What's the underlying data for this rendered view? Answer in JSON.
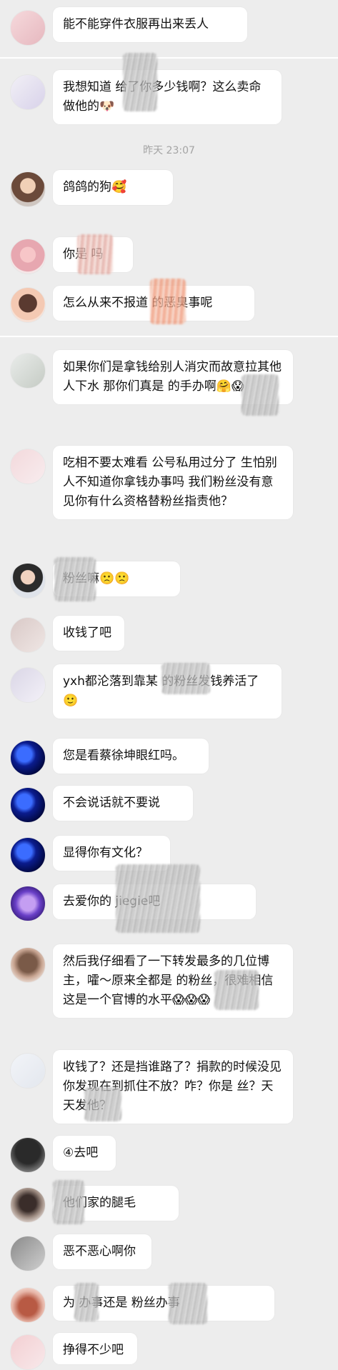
{
  "messages": [
    {
      "text": "能不能穿件衣服再出来丢人"
    },
    {
      "text": "我想知道        给了你多少钱啊？这么卖命做他的🐶"
    },
    {
      "text": "      鸽鸽的狗🥰"
    },
    {
      "text": "你是        吗"
    },
    {
      "text": "怎么从来不报道        的恶臭事呢"
    },
    {
      "text": "如果你们是拿钱给别人消灾而故意拉其他人下水 那你们真是       的手办啊🤗😱"
    },
    {
      "text": "吃相不要太难看 公号私用过分了 生怕别人不知道你拿钱办事吗 我们粉丝没有意见你有什么资格替粉丝指责他？"
    },
    {
      "text": "        粉丝嘛🙁🙁"
    },
    {
      "text": "收钱了吧"
    },
    {
      "text": "yxh都沦落到靠某        的粉丝发钱养活了🙂"
    },
    {
      "text": "您是看蔡徐坤眼红吗。"
    },
    {
      "text": "不会说话就不要说"
    },
    {
      "text": "显得你有文化？"
    },
    {
      "text": "去爱你的                  jiegie吧"
    },
    {
      "text": "然后我仔细看了一下转发最多的几位博主，嚯～原来全都是         的粉丝，很难相信这是一个官博的水平😱😱😱"
    },
    {
      "text": "收钱了？还是挡谁路了？捐款的时候没见你发现在到抓住不放？咋？你是       丝？天天发他？"
    },
    {
      "text": "④去吧"
    },
    {
      "text": "      他们家的腿毛"
    },
    {
      "text": "恶不恶心啊你"
    },
    {
      "text": "为        办事还是           粉丝办事"
    },
    {
      "text": "挣得不少吧"
    }
  ],
  "timestamp": "昨天 23:07",
  "colors": {
    "background": "#ededed",
    "bubble": "#ffffff",
    "text": "#111111",
    "timestamp": "#a4a4a4"
  }
}
